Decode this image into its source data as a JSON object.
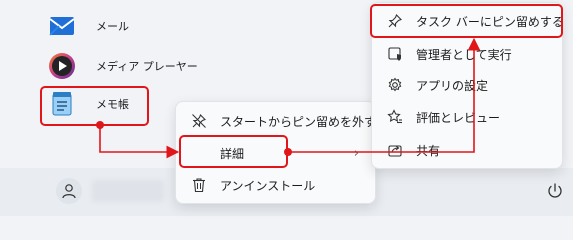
{
  "apps": [
    {
      "label": "メール",
      "icon": "mail-icon"
    },
    {
      "label": "メディア プレーヤー",
      "icon": "media-player-icon"
    },
    {
      "label": "メモ帳",
      "icon": "notepad-icon"
    }
  ],
  "context_menu": {
    "items": [
      {
        "label": "スタートからピン留めを外す",
        "icon": "unpin-icon"
      },
      {
        "label": "詳細",
        "icon": "",
        "has_submenu": true,
        "submenu_arrow": "›"
      },
      {
        "label": "アンインストール",
        "icon": "trash-icon"
      }
    ]
  },
  "submenu": {
    "items": [
      {
        "label": "タスク バーにピン留めする",
        "icon": "pin-icon"
      },
      {
        "label": "管理者として実行",
        "icon": "shield-admin-icon"
      },
      {
        "label": "アプリの設定",
        "icon": "gear-icon"
      },
      {
        "label": "評価とレビュー",
        "icon": "star-review-icon"
      },
      {
        "label": "共有",
        "icon": "share-icon"
      }
    ]
  },
  "colors": {
    "highlight": "#e0161b",
    "background": "#f1f3f7",
    "menu_background": "#f9fafb"
  },
  "footer": {
    "user_icon": "user-avatar-icon",
    "power_icon": "power-icon"
  }
}
